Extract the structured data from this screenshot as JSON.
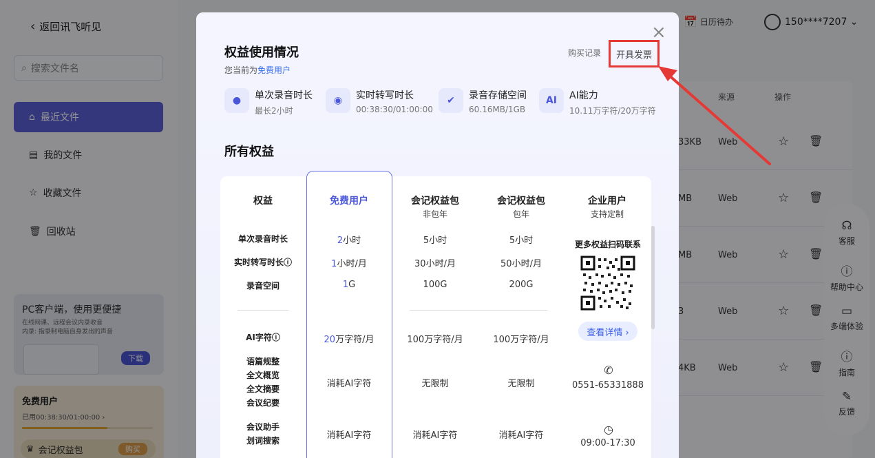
{
  "sidebar": {
    "back_label": "返回讯飞听见",
    "search_placeholder": "搜索文件名",
    "nav": [
      {
        "label": "最近文件",
        "icon": "home-icon"
      },
      {
        "label": "我的文件",
        "icon": "file-icon"
      },
      {
        "label": "收藏文件",
        "icon": "star-file-icon"
      },
      {
        "label": "回收站",
        "icon": "trash-icon"
      }
    ],
    "promo": {
      "title": "PC客户端，使用更便捷",
      "line1": "在线网课、远程会议内录收音",
      "line2": "内录: 指录制电脑自身发出的声音",
      "download": "下载"
    },
    "account": {
      "title": "免费用户",
      "usage": "已用00:38:30/01:00:00 ›",
      "pack": "会记权益包",
      "buy": "购买"
    }
  },
  "topbar": {
    "calendar": "日历待办",
    "user": "150****7207 ⌄"
  },
  "list": {
    "headers": {
      "source": "来源",
      "ops": "操作"
    },
    "rows": [
      {
        "size": "33KB",
        "source": "Web"
      },
      {
        "size": "MB",
        "source": "Web"
      },
      {
        "size": "MB",
        "source": "Web"
      },
      {
        "size": "3",
        "source": "Web"
      },
      {
        "size": "4KB",
        "source": "Web"
      }
    ]
  },
  "helpbar": [
    {
      "label": "客服",
      "icon": "headset-icon"
    },
    {
      "label": "帮助中心",
      "icon": "question-icon"
    },
    {
      "label": "多端体验",
      "icon": "monitor-icon"
    },
    {
      "label": "指南",
      "icon": "info-icon"
    },
    {
      "label": "反馈",
      "icon": "pen-icon"
    }
  ],
  "modal": {
    "title": "权益使用情况",
    "subtitle_prefix": "您当前为",
    "subtitle_user": "免费用户",
    "purchase_record": "购买记录",
    "invoice": "开具发票",
    "stats": [
      {
        "name": "单次录音时长",
        "value": "最长2小时",
        "icon_text": "●"
      },
      {
        "name": "实时转写时长",
        "value": "00:38:30/01:00:00",
        "icon_text": "◉"
      },
      {
        "name": "录音存储空间",
        "value": "60.16MB/1GB",
        "icon_text": "✔"
      },
      {
        "name": "AI能力",
        "value": "10.11万字符/20万字符",
        "icon_text": "AI"
      }
    ],
    "section_title": "所有权益",
    "columns": [
      {
        "title": "权益",
        "sub": ""
      },
      {
        "title": "免费用户",
        "sub": ""
      },
      {
        "title": "会记权益包",
        "sub": "非包年"
      },
      {
        "title": "会记权益包",
        "sub": "包年"
      },
      {
        "title": "企业用户",
        "sub": "支持定制"
      }
    ],
    "rows": {
      "single_record": {
        "label": "单次录音时长",
        "free_num": "2",
        "free_unit": "小时",
        "pack": "5小时",
        "year": "5小时"
      },
      "realtime": {
        "label": "实时转写时长ⓘ",
        "free_num": "1",
        "free_unit": "小时/月",
        "pack": "30小时/月",
        "year": "50小时/月"
      },
      "space": {
        "label": "录音空间",
        "free_num": "1",
        "free_unit": "G",
        "pack": "100G",
        "year": "200G"
      },
      "ai": {
        "label": "AI字符ⓘ",
        "free_num": "20",
        "free_unit": "万字符/月",
        "pack": "100万字符/月",
        "year": "100万字符/月"
      },
      "features1": {
        "labels": [
          "语篇规整",
          "全文概览",
          "全文摘要",
          "会议纪要"
        ],
        "free": "消耗AI字符",
        "pack": "无限制",
        "year": "无限制"
      },
      "features2": {
        "labels": [
          "会议助手",
          "划词搜索"
        ],
        "free": "消耗AI字符",
        "pack": "消耗AI字符",
        "year": "消耗AI字符"
      }
    },
    "enterprise": {
      "qr_title": "更多权益扫码联系",
      "detail": "查看详情 ›",
      "phone": "0551-65331888",
      "hours": "09:00-17:30"
    }
  }
}
